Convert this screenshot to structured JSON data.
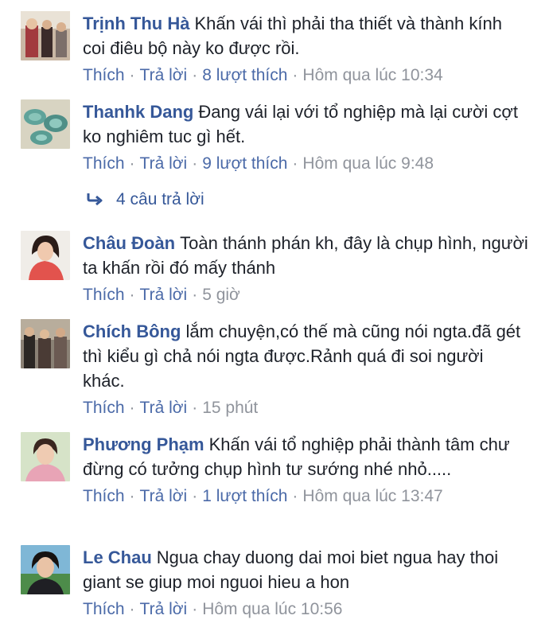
{
  "comments": [
    {
      "author": "Trịnh Thu Hà",
      "text": "Khấn vái thì phải tha thiết và thành kính coi điêu bộ này ko được rồi.",
      "like_label": "Thích",
      "reply_label": "Trả lời",
      "likes": "8 lượt thích",
      "time": "Hôm qua lúc 10:34"
    },
    {
      "author": "Thanhk Dang",
      "text": "Đang vái lại với tổ nghiệp mà lại cười cợt ko nghiêm tuc gì hết.",
      "like_label": "Thích",
      "reply_label": "Trả lời",
      "likes": "9 lượt thích",
      "time": "Hôm qua lúc 9:48"
    },
    {
      "author": "Châu Đoàn",
      "text": "Toàn thánh phán kh, đây là chụp hình, người ta khấn rồi đó mấy thánh",
      "like_label": "Thích",
      "reply_label": "Trả lời",
      "time": "5 giờ"
    },
    {
      "author": "Chích Bông",
      "text": "lắm chuyện,có thế mà cũng nói ngta.đã gét thì kiểu gì chả nói ngta được.Rảnh quá đi soi người khác.",
      "like_label": "Thích",
      "reply_label": "Trả lời",
      "time": "15 phút"
    },
    {
      "author": "Phương Phạm",
      "text": "Khấn vái tổ nghiệp phải thành tâm chư đừng có tưởng chụp hình tư sướng nhé nhỏ.....",
      "like_label": "Thích",
      "reply_label": "Trả lời",
      "likes": "1 lượt thích",
      "time": "Hôm qua lúc 13:47"
    },
    {
      "author": "Le Chau",
      "text": "Ngua chay duong dai moi biet ngua hay thoi giant se giup moi nguoi hieu a hon",
      "like_label": "Thích",
      "reply_label": "Trả lời",
      "time": "Hôm qua lúc 10:56"
    }
  ],
  "replies_link": "4 câu trả lời",
  "icons": {
    "reply_arrow": "reply-arrow-icon"
  },
  "colors": {
    "author": "#365899",
    "link": "#4b6aa8",
    "meta": "#90949c",
    "text": "#1d2129"
  }
}
